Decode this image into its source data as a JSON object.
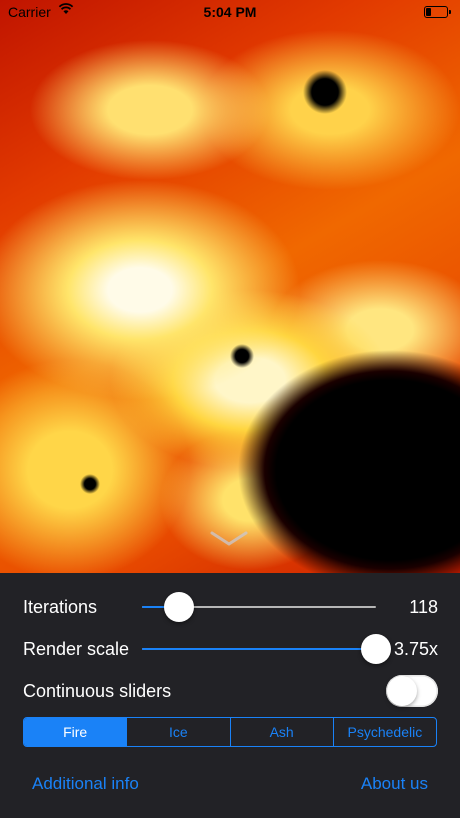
{
  "status_bar": {
    "carrier": "Carrier",
    "time": "5:04 PM"
  },
  "fractal": {
    "description_icon": "mandelbrot-fractal-image"
  },
  "controls": {
    "iterations": {
      "label": "Iterations",
      "value": "118",
      "fraction": 0.16
    },
    "render_scale": {
      "label": "Render scale",
      "value": "3.75x",
      "fraction": 1.0
    },
    "continuous_sliders": {
      "label": "Continuous sliders",
      "on": false
    }
  },
  "palette": {
    "options": [
      "Fire",
      "Ice",
      "Ash",
      "Psychedelic"
    ],
    "selected": "Fire"
  },
  "links": {
    "additional_info": "Additional info",
    "about_us": "About us"
  },
  "colors": {
    "accent": "#1a82f7",
    "panel_bg": "#222226"
  }
}
